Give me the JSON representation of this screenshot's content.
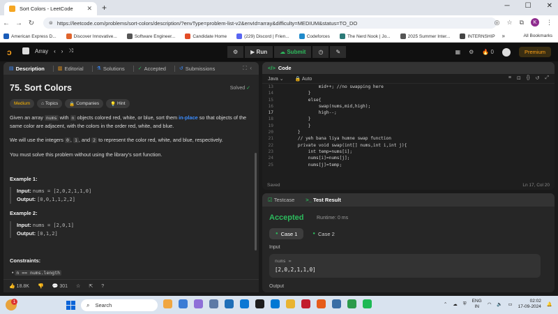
{
  "browser": {
    "tab_title": "Sort Colors - LeetCode",
    "new_tab": "+",
    "url": "https://leetcode.com/problems/sort-colors/description/?envType=problem-list-v2&envId=array&difficulty=MEDIUM&status=TO_DO",
    "profile_initial": "K",
    "bookmarks": [
      {
        "label": "American Express D...",
        "color": "#1a5cb8"
      },
      {
        "label": "Discover Innovative...",
        "color": "#e0642c"
      },
      {
        "label": "Software Engineer...",
        "color": "#555555"
      },
      {
        "label": "Candidate Home",
        "color": "#e34c26"
      },
      {
        "label": "(229) Discord | Frien...",
        "color": "#5865f2"
      },
      {
        "label": "Codeforces",
        "color": "#1f8acb"
      },
      {
        "label": "The Nerd Nook | Jo...",
        "color": "#2b7a78"
      },
      {
        "label": "2025 Summer Inter...",
        "color": "#555555"
      },
      {
        "label": "INTERNSHIP",
        "color": "#444444"
      }
    ],
    "all_bookmarks": "All Bookmarks"
  },
  "lc_nav": {
    "problem_list": "Array",
    "run": "Run",
    "submit": "Submit",
    "streak": "0",
    "premium": "Premium"
  },
  "left_tabs": [
    "Description",
    "Editorial",
    "Solutions",
    "Accepted",
    "Submissions"
  ],
  "problem": {
    "title": "75. Sort Colors",
    "status": "Solved",
    "tags": [
      "Medium",
      "Topics",
      "Companies",
      "Hint"
    ],
    "desc_p1_a": "Given an array ",
    "desc_p1_code1": "nums",
    "desc_p1_b": " with ",
    "desc_p1_code2": "n",
    "desc_p1_c": " objects colored red, white, or blue, sort them ",
    "desc_p1_hl": "in-place",
    "desc_p1_d": " so that objects of the same color are adjacent, with the colors in the order red, white, and blue.",
    "desc_p2_a": "We will use the integers ",
    "desc_p2_c0": "0",
    "desc_p2_c1": "1",
    "desc_p2_and": ", and ",
    "desc_p2_c2": "2",
    "desc_p2_b": " to represent the color red, white, and blue, respectively.",
    "desc_p3": "You must solve this problem without using the library's sort function.",
    "example1_title": "Example 1:",
    "example1_input_label": "Input:",
    "example1_input": "nums = [2,0,2,1,1,0]",
    "example1_output_label": "Output:",
    "example1_output": "[0,0,1,1,2,2]",
    "example2_title": "Example 2:",
    "example2_input_label": "Input:",
    "example2_input": "nums = [2,0,1]",
    "example2_output_label": "Output:",
    "example2_output": "[0,1,2]",
    "constraints_title": "Constraints:",
    "constraint1": "n == nums.length"
  },
  "footer": {
    "likes": "18.8K",
    "comments": "301"
  },
  "code": {
    "header": "Code",
    "language": "Java",
    "mode": "Auto",
    "status": "Saved",
    "position": "Ln 17, Col 20",
    "lines": [
      {
        "n": "13",
        "t": "            mid++; //no swapping here"
      },
      {
        "n": "14",
        "t": "        }"
      },
      {
        "n": "15",
        "t": "        else{"
      },
      {
        "n": "16",
        "t": "            swap(nums,mid,high);"
      },
      {
        "n": "17",
        "t": "            high--;"
      },
      {
        "n": "18",
        "t": "        }"
      },
      {
        "n": "19",
        "t": "        }"
      },
      {
        "n": "20",
        "t": "    }"
      },
      {
        "n": "21",
        "t": "    // yeh bana liya humne swap function"
      },
      {
        "n": "22",
        "t": "    private void swap(int[] nums,int i,int j){"
      },
      {
        "n": "23",
        "t": "        int temp=nums[i];"
      },
      {
        "n": "24",
        "t": "        nums[i]=nums[j];"
      },
      {
        "n": "25",
        "t": "        nums[j]=temp;"
      }
    ]
  },
  "test": {
    "tab_testcase": "Testcase",
    "tab_result": "Test Result",
    "verdict": "Accepted",
    "runtime": "Runtime: 0 ms",
    "cases": [
      "Case 1",
      "Case 2"
    ],
    "input_label": "Input",
    "input_name": "nums =",
    "input_value": "[2,0,2,1,1,0]",
    "output_label": "Output"
  },
  "taskbar": {
    "notif_count": "1",
    "search_placeholder": "Search",
    "lang_1": "ENG",
    "lang_2": "IN",
    "time": "02:02",
    "date": "17-09-2024"
  }
}
